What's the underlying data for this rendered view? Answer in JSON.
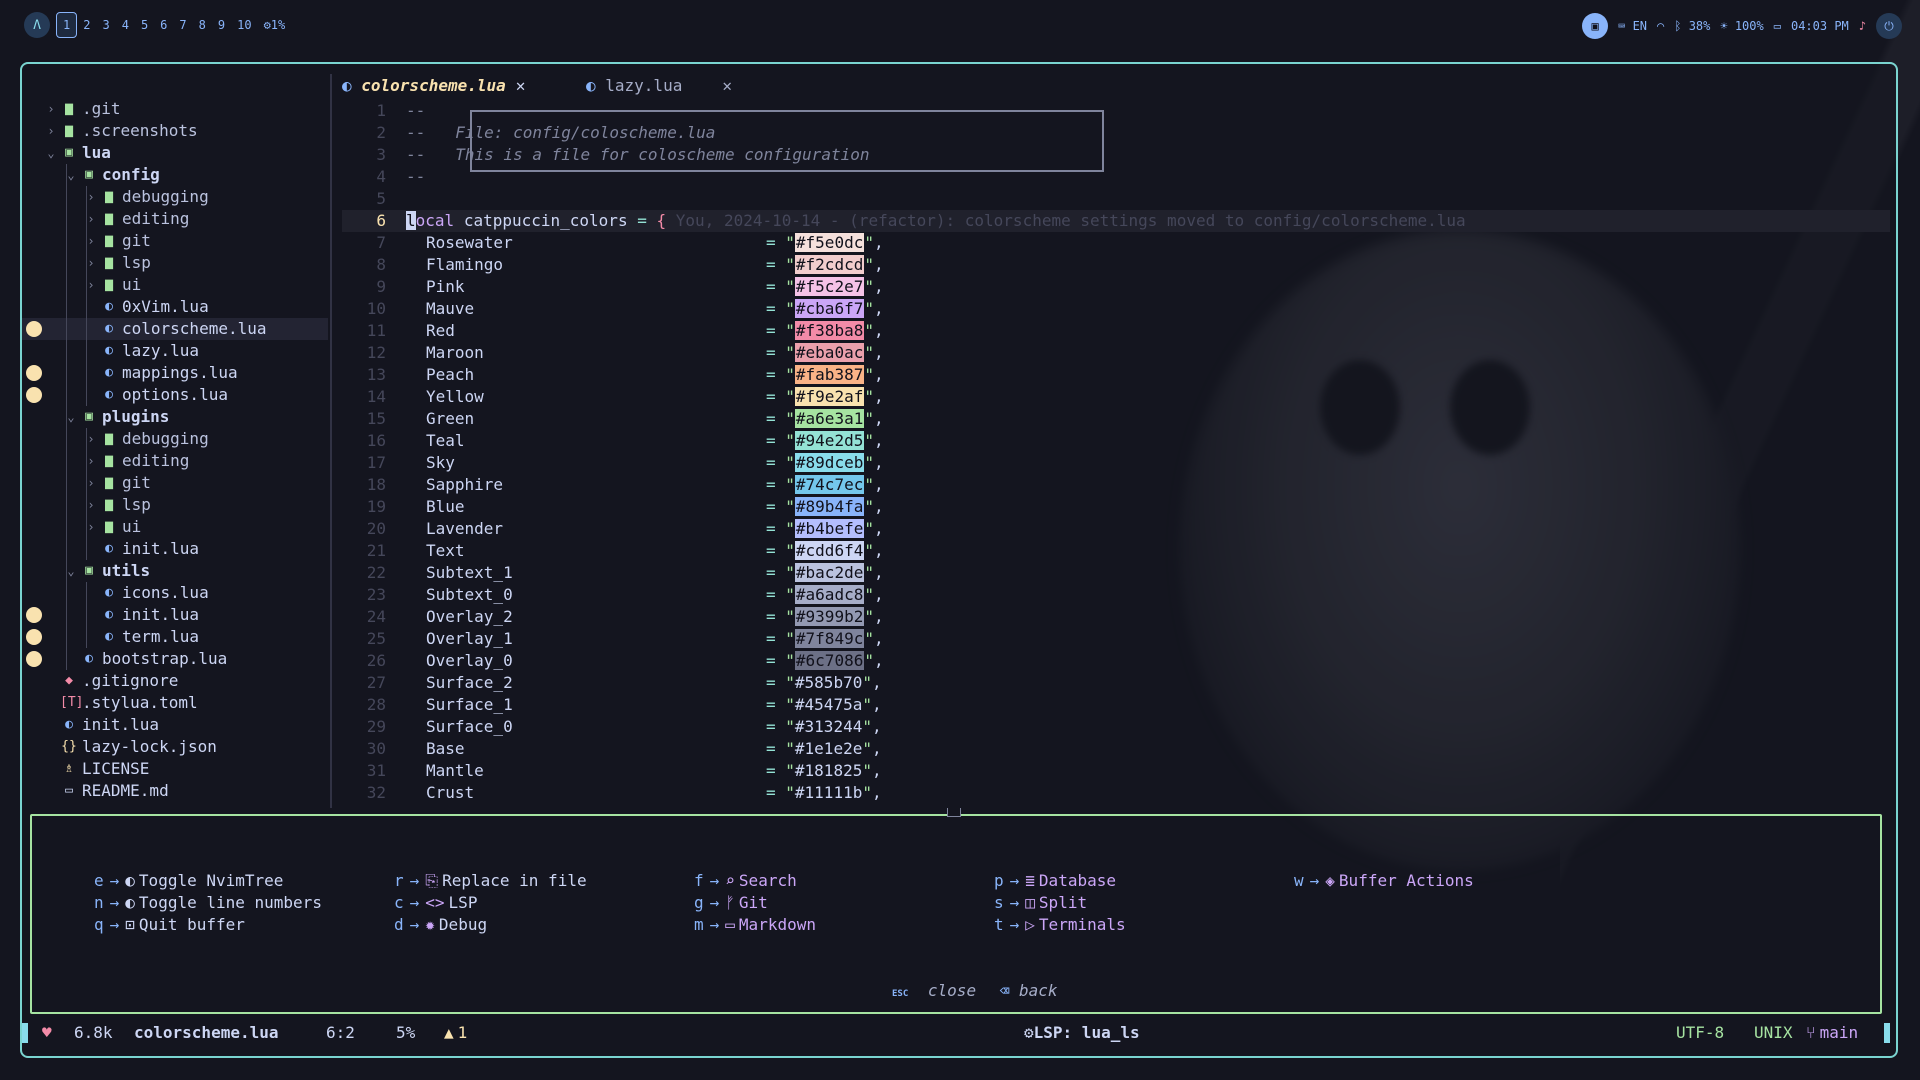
{
  "topbar": {
    "logo": "Λ",
    "workspaces": [
      "1",
      "2",
      "3",
      "4",
      "5",
      "6",
      "7",
      "8",
      "9",
      "10"
    ],
    "active_workspace": "1",
    "cpu": "⚙1%",
    "lang": "EN",
    "battery": "38%",
    "brightness": "100%",
    "time": "04:03 PM"
  },
  "tabs": [
    {
      "label": "colorscheme.lua",
      "close": "✕",
      "active": true
    },
    {
      "label": "lazy.lua",
      "close": "✕",
      "active": false
    }
  ],
  "tree": [
    {
      "name": ".git",
      "depth": 0,
      "type": "dir",
      "open": false,
      "icon": "folder-icon",
      "glyph": "▆"
    },
    {
      "name": ".screenshots",
      "depth": 0,
      "type": "dir",
      "open": false,
      "icon": "folder-icon",
      "glyph": "▆"
    },
    {
      "name": "lua",
      "depth": 0,
      "type": "dir",
      "open": true,
      "icon": "folder-open-icon",
      "glyph": "▣",
      "bold": true
    },
    {
      "name": "config",
      "depth": 1,
      "type": "dir",
      "open": true,
      "icon": "folder-open-icon",
      "glyph": "▣",
      "bold": true
    },
    {
      "name": "debugging",
      "depth": 2,
      "type": "dir",
      "open": false,
      "icon": "folder-icon",
      "glyph": "▆"
    },
    {
      "name": "editing",
      "depth": 2,
      "type": "dir",
      "open": false,
      "icon": "folder-icon",
      "glyph": "▆"
    },
    {
      "name": "git",
      "depth": 2,
      "type": "dir",
      "open": false,
      "icon": "folder-icon",
      "glyph": "▆"
    },
    {
      "name": "lsp",
      "depth": 2,
      "type": "dir",
      "open": false,
      "icon": "folder-icon",
      "glyph": "▆"
    },
    {
      "name": "ui",
      "depth": 2,
      "type": "dir",
      "open": false,
      "icon": "folder-icon",
      "glyph": "▆"
    },
    {
      "name": "0xVim.lua",
      "depth": 2,
      "type": "file",
      "icon": "lua-icon",
      "glyph": "◐"
    },
    {
      "name": "colorscheme.lua",
      "depth": 2,
      "type": "file",
      "icon": "lua-icon",
      "glyph": "◐",
      "selected": true,
      "modified": true
    },
    {
      "name": "lazy.lua",
      "depth": 2,
      "type": "file",
      "icon": "lua-icon",
      "glyph": "◐"
    },
    {
      "name": "mappings.lua",
      "depth": 2,
      "type": "file",
      "icon": "lua-icon",
      "glyph": "◐",
      "modified": true
    },
    {
      "name": "options.lua",
      "depth": 2,
      "type": "file",
      "icon": "lua-icon",
      "glyph": "◐",
      "modified": true
    },
    {
      "name": "plugins",
      "depth": 1,
      "type": "dir",
      "open": true,
      "icon": "folder-open-icon",
      "glyph": "▣",
      "bold": true
    },
    {
      "name": "debugging",
      "depth": 2,
      "type": "dir",
      "open": false,
      "icon": "folder-icon",
      "glyph": "▆"
    },
    {
      "name": "editing",
      "depth": 2,
      "type": "dir",
      "open": false,
      "icon": "folder-icon",
      "glyph": "▆"
    },
    {
      "name": "git",
      "depth": 2,
      "type": "dir",
      "open": false,
      "icon": "folder-icon",
      "glyph": "▆"
    },
    {
      "name": "lsp",
      "depth": 2,
      "type": "dir",
      "open": false,
      "icon": "folder-icon",
      "glyph": "▆"
    },
    {
      "name": "ui",
      "depth": 2,
      "type": "dir",
      "open": false,
      "icon": "folder-icon",
      "glyph": "▆"
    },
    {
      "name": "init.lua",
      "depth": 2,
      "type": "file",
      "icon": "lua-icon",
      "glyph": "◐"
    },
    {
      "name": "utils",
      "depth": 1,
      "type": "dir",
      "open": true,
      "icon": "folder-open-icon",
      "glyph": "▣",
      "bold": true
    },
    {
      "name": "icons.lua",
      "depth": 2,
      "type": "file",
      "icon": "lua-icon",
      "glyph": "◐"
    },
    {
      "name": "init.lua",
      "depth": 2,
      "type": "file",
      "icon": "lua-icon",
      "glyph": "◐",
      "modified": true
    },
    {
      "name": "term.lua",
      "depth": 2,
      "type": "file",
      "icon": "lua-icon",
      "glyph": "◐",
      "modified": true
    },
    {
      "name": "bootstrap.lua",
      "depth": 1,
      "type": "file",
      "icon": "lua-icon",
      "glyph": "◐",
      "modified": true
    },
    {
      "name": ".gitignore",
      "depth": 0,
      "type": "file",
      "icon": "git-icon",
      "glyph": "◆"
    },
    {
      "name": ".stylua.toml",
      "depth": 0,
      "type": "file",
      "icon": "toml-icon",
      "glyph": "[T]"
    },
    {
      "name": "init.lua",
      "depth": 0,
      "type": "file",
      "icon": "lua-icon",
      "glyph": "◐"
    },
    {
      "name": "lazy-lock.json",
      "depth": 0,
      "type": "file",
      "icon": "json-icon",
      "glyph": "{}"
    },
    {
      "name": "LICENSE",
      "depth": 0,
      "type": "file",
      "icon": "license-icon",
      "glyph": "♗"
    },
    {
      "name": "README.md",
      "depth": 0,
      "type": "file",
      "icon": "markdown-icon",
      "glyph": "▭"
    }
  ],
  "header_comment": {
    "line1_num": "1",
    "line2_num": "2",
    "line3_num": "3",
    "line4_num": "4",
    "line5_num": "5",
    "dash": "--",
    "file_line": "File: config/coloscheme.lua",
    "desc_line": "This is a file for coloscheme configuration"
  },
  "cursor_line": {
    "num": "6",
    "first_char": "l",
    "keyword_rest": "ocal",
    "ident": "catppuccin_colors",
    "eq": "=",
    "brace": "{",
    "blame": "You, 2024-10-14 - (refactor): colorscheme settings moved to config/colorscheme.lua"
  },
  "colors": [
    {
      "num": "7",
      "name": "Rosewater",
      "hex": "#f5e0dc"
    },
    {
      "num": "8",
      "name": "Flamingo",
      "hex": "#f2cdcd"
    },
    {
      "num": "9",
      "name": "Pink",
      "hex": "#f5c2e7"
    },
    {
      "num": "10",
      "name": "Mauve",
      "hex": "#cba6f7"
    },
    {
      "num": "11",
      "name": "Red",
      "hex": "#f38ba8"
    },
    {
      "num": "12",
      "name": "Maroon",
      "hex": "#eba0ac"
    },
    {
      "num": "13",
      "name": "Peach",
      "hex": "#fab387"
    },
    {
      "num": "14",
      "name": "Yellow",
      "hex": "#f9e2af"
    },
    {
      "num": "15",
      "name": "Green",
      "hex": "#a6e3a1"
    },
    {
      "num": "16",
      "name": "Teal",
      "hex": "#94e2d5"
    },
    {
      "num": "17",
      "name": "Sky",
      "hex": "#89dceb"
    },
    {
      "num": "18",
      "name": "Sapphire",
      "hex": "#74c7ec"
    },
    {
      "num": "19",
      "name": "Blue",
      "hex": "#89b4fa"
    },
    {
      "num": "20",
      "name": "Lavender",
      "hex": "#b4befe"
    },
    {
      "num": "21",
      "name": "Text",
      "hex": "#cdd6f4"
    },
    {
      "num": "22",
      "name": "Subtext_1",
      "hex": "#bac2de"
    },
    {
      "num": "23",
      "name": "Subtext_0",
      "hex": "#a6adc8"
    },
    {
      "num": "24",
      "name": "Overlay_2",
      "hex": "#9399b2"
    },
    {
      "num": "25",
      "name": "Overlay_1",
      "hex": "#7f849c"
    },
    {
      "num": "26",
      "name": "Overlay_0",
      "hex": "#6c7086"
    },
    {
      "num": "27",
      "name": "Surface_2",
      "hex": "#585b70"
    },
    {
      "num": "28",
      "name": "Surface_1",
      "hex": "#45475a"
    },
    {
      "num": "29",
      "name": "Surface_0",
      "hex": "#313244"
    },
    {
      "num": "30",
      "name": "Base",
      "hex": "#1e1e2e"
    },
    {
      "num": "31",
      "name": "Mantle",
      "hex": "#181825"
    },
    {
      "num": "32",
      "name": "Crust",
      "hex": "#11111b"
    }
  ],
  "whichkey": {
    "arrow": "→",
    "col1": [
      {
        "key": "e",
        "icon": "toggle-icon",
        "glyph": "◐",
        "label": "Toggle NvimTree"
      },
      {
        "key": "n",
        "icon": "toggle-icon",
        "glyph": "◐",
        "label": "Toggle line numbers"
      },
      {
        "key": "q",
        "icon": "quit-icon",
        "glyph": "⊡",
        "label": "Quit buffer"
      }
    ],
    "col2": [
      {
        "key": "r",
        "icon": "replace-icon",
        "glyph": "⎘",
        "label": "Replace in file"
      },
      {
        "key": "c",
        "icon": "code-icon",
        "glyph": "<>",
        "label": "LSP"
      },
      {
        "key": "d",
        "icon": "bug-icon",
        "glyph": "✹",
        "label": "Debug"
      }
    ],
    "col3": [
      {
        "key": "f",
        "icon": "search-icon",
        "glyph": "⌕",
        "label": "Search"
      },
      {
        "key": "g",
        "icon": "git-branch-icon",
        "glyph": "ᚠ",
        "label": "Git"
      },
      {
        "key": "m",
        "icon": "markdown-icon",
        "glyph": "▭",
        "label": "Markdown"
      }
    ],
    "col4": [
      {
        "key": "p",
        "icon": "database-icon",
        "glyph": "≣",
        "label": "Database"
      },
      {
        "key": "s",
        "icon": "split-icon",
        "glyph": "◫",
        "label": "Split"
      },
      {
        "key": "t",
        "icon": "terminal-icon",
        "glyph": "▷",
        "label": "Terminals"
      }
    ],
    "col5": [
      {
        "key": "w",
        "icon": "layers-icon",
        "glyph": "◈",
        "label": "Buffer Actions"
      }
    ],
    "esc_key": "ESC",
    "close_label": "close",
    "back_icon": "⌫",
    "back_label": "back"
  },
  "status": {
    "size": "6.8k",
    "filename": "colorscheme.lua",
    "position": "6:2",
    "percent": "5%",
    "warn_icon": "▲",
    "warnings": "1",
    "lsp": "LSP: lua_ls",
    "encoding": "UTF-8",
    "format": "UNIX",
    "branch": "main"
  },
  "palette": {
    "accent": "#89b4fa",
    "border": "#7ad4d0",
    "whichkey_border": "#a6e3a1",
    "modified_dot": "#f9e2af"
  }
}
